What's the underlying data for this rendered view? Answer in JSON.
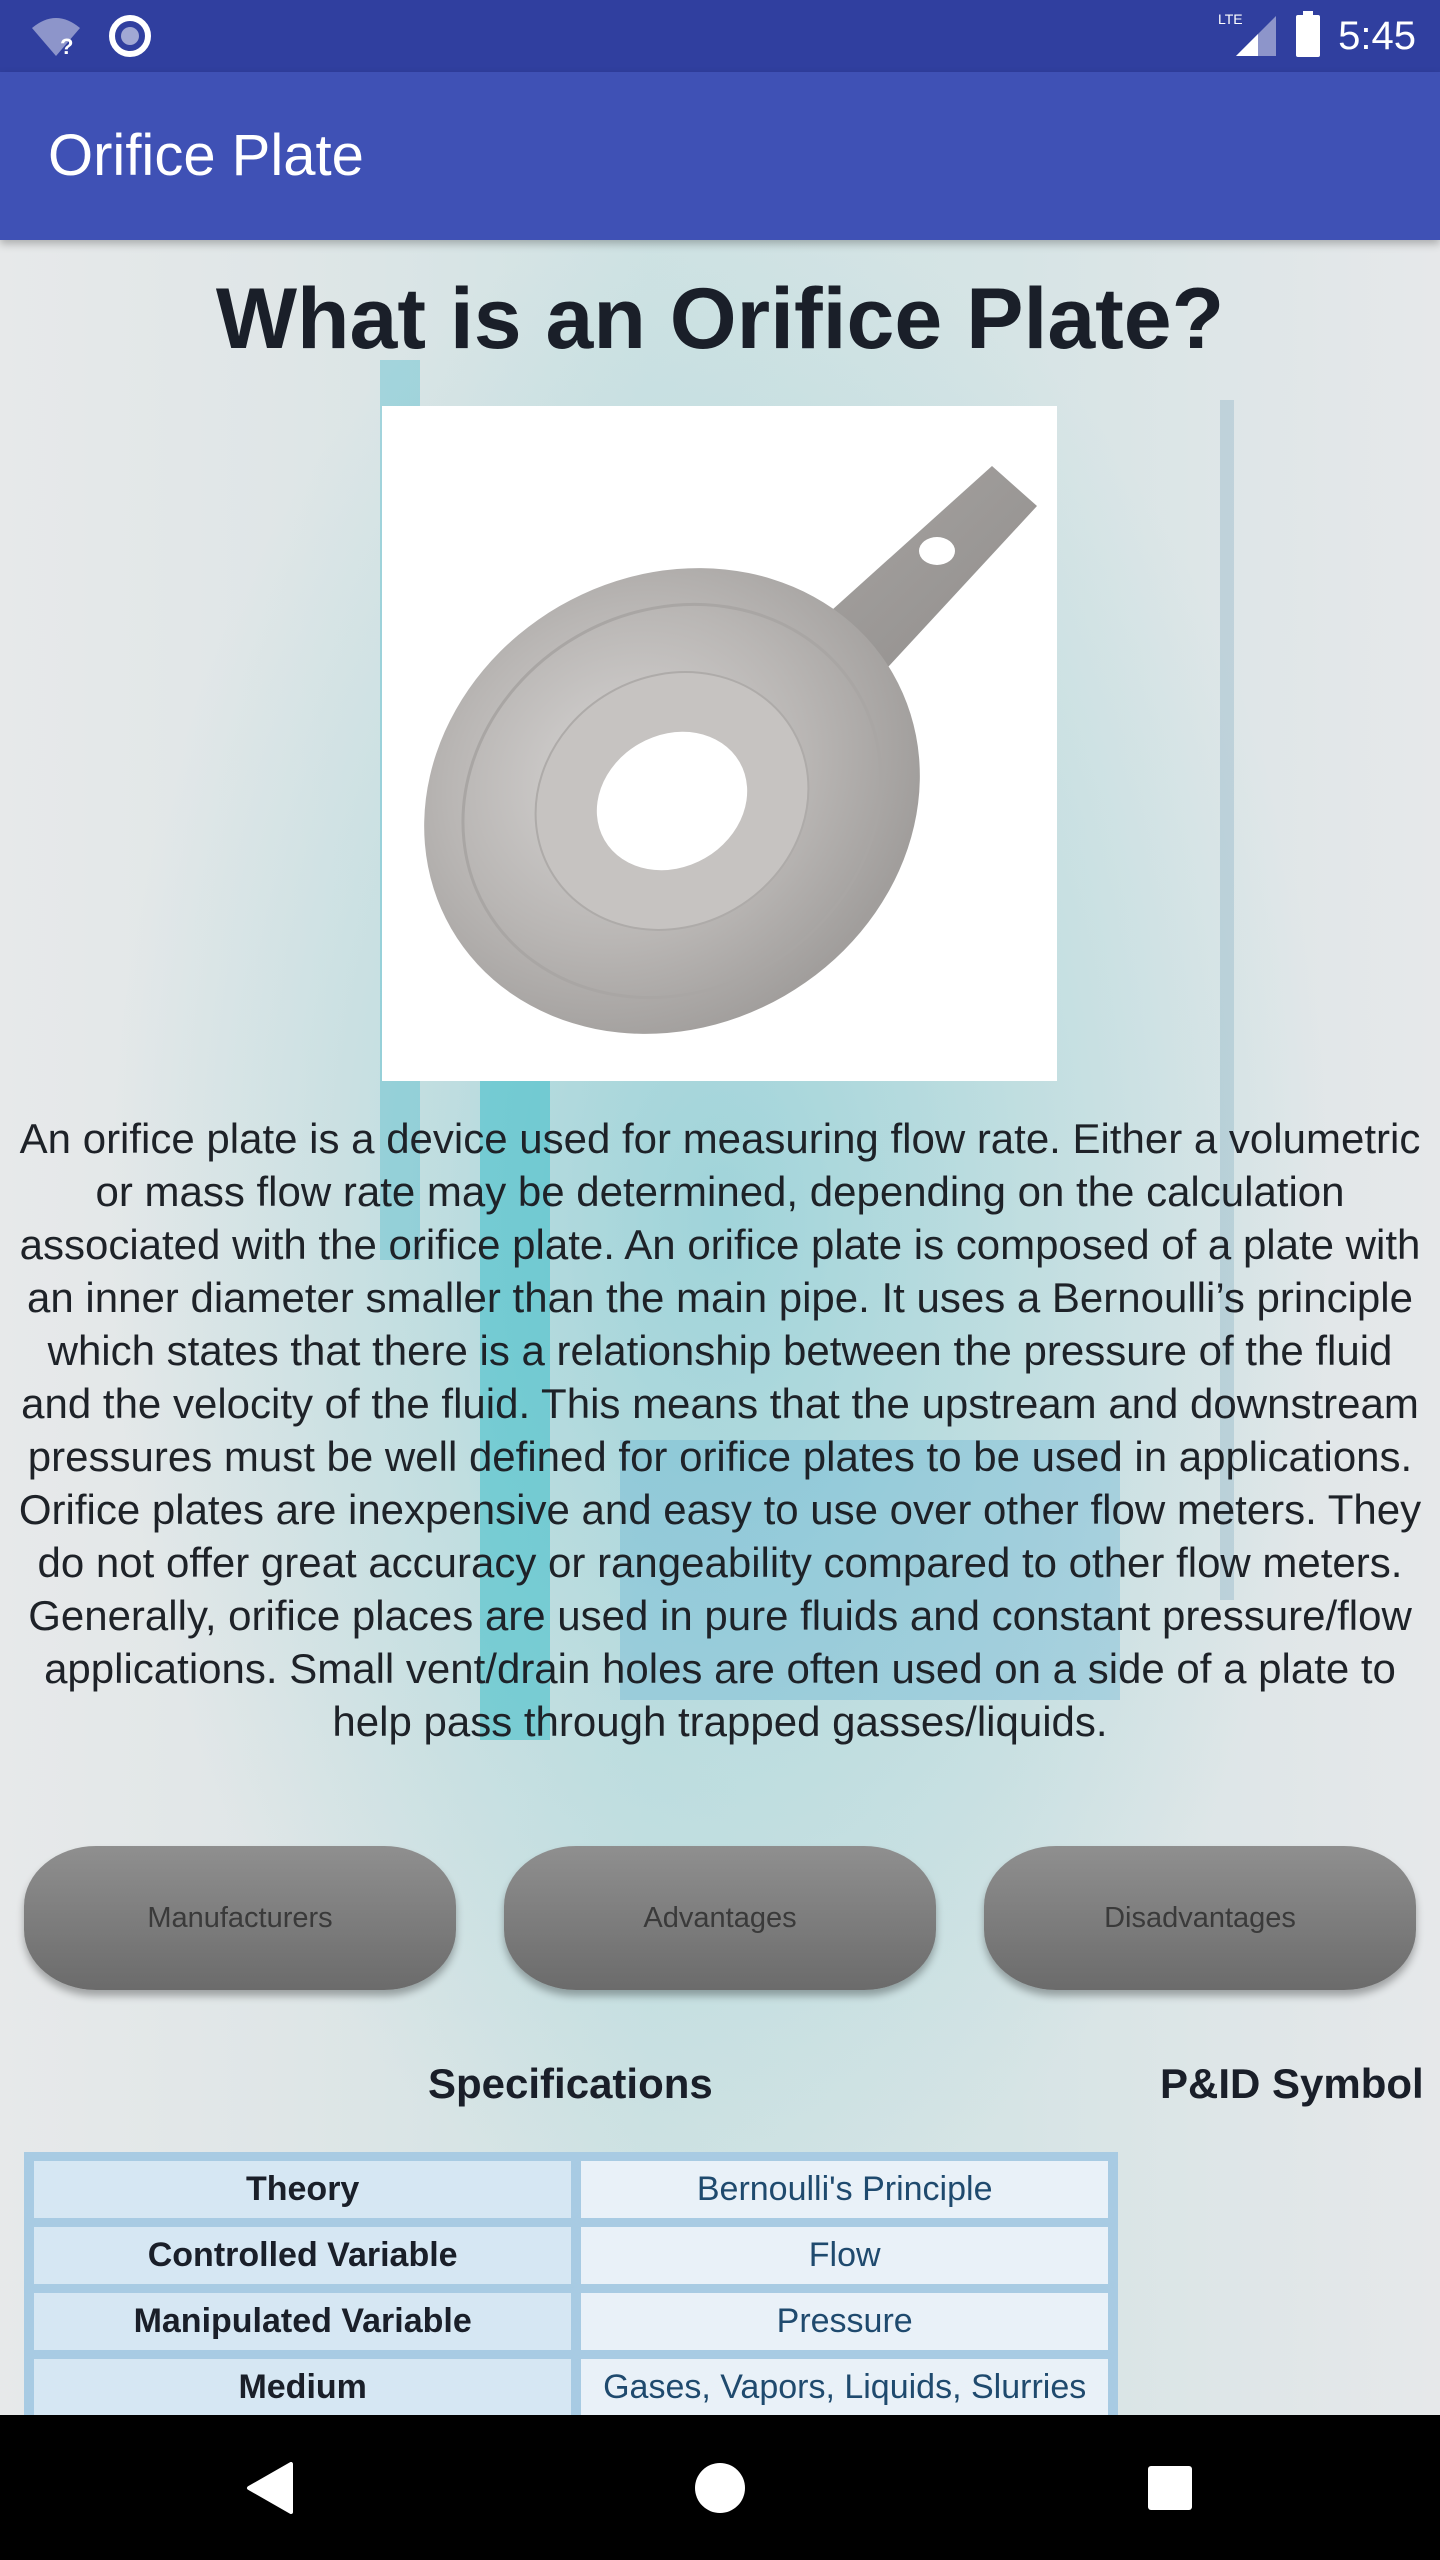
{
  "status_bar": {
    "time": "5:45",
    "network_label": "LTE",
    "icons": [
      "wifi-unknown-icon",
      "sync-circle-icon",
      "lte-signal-icon",
      "battery-icon"
    ]
  },
  "app_bar": {
    "title": "Orifice Plate"
  },
  "main": {
    "heading": "What is an Orifice Plate?",
    "image_alt": "orifice plate photo",
    "description": "An orifice plate is a device used for measuring flow rate. Either a volumetric or mass flow rate may be determined, depending on the calculation associated with the orifice plate. An orifice plate is composed of a plate with an inner diameter smaller than the main pipe. It uses a Bernoulli’s principle which states that there is a relationship between the pressure of the fluid and the velocity of the fluid. This means that the upstream and downstream pressures must be well defined for orifice plates to be used in applications. Orifice plates are inexpensive and easy to use over other flow meters. They do not offer great accuracy or rangeability compared to other flow meters. Generally, orifice places are used in pure fluids and constant pressure/flow applications. Small vent/drain holes are often used on a side of a plate to help pass through trapped gasses/liquids.",
    "buttons": [
      {
        "label": "Manufacturers"
      },
      {
        "label": "Advantages"
      },
      {
        "label": "Disadvantages"
      }
    ],
    "specifications_title": "Specifications",
    "pid_symbol_title": "P&ID Symbol",
    "specifications": [
      {
        "key": "Theory",
        "value": "Bernoulli's Principle"
      },
      {
        "key": "Controlled Variable",
        "value": "Flow"
      },
      {
        "key": "Manipulated Variable",
        "value": "Pressure"
      },
      {
        "key": "Medium",
        "value": "Gases, Vapors, Liquids, Slurries"
      }
    ]
  },
  "nav_bar": {
    "buttons": [
      "back",
      "home",
      "recents"
    ]
  },
  "colors": {
    "status_bar": "#303f9f",
    "app_bar": "#3f51b5",
    "table_border": "#a8cbe3",
    "table_key_bg": "#d6e7f3",
    "table_value_bg": "#e9f1f8",
    "table_value_text": "#1f4a6e"
  }
}
